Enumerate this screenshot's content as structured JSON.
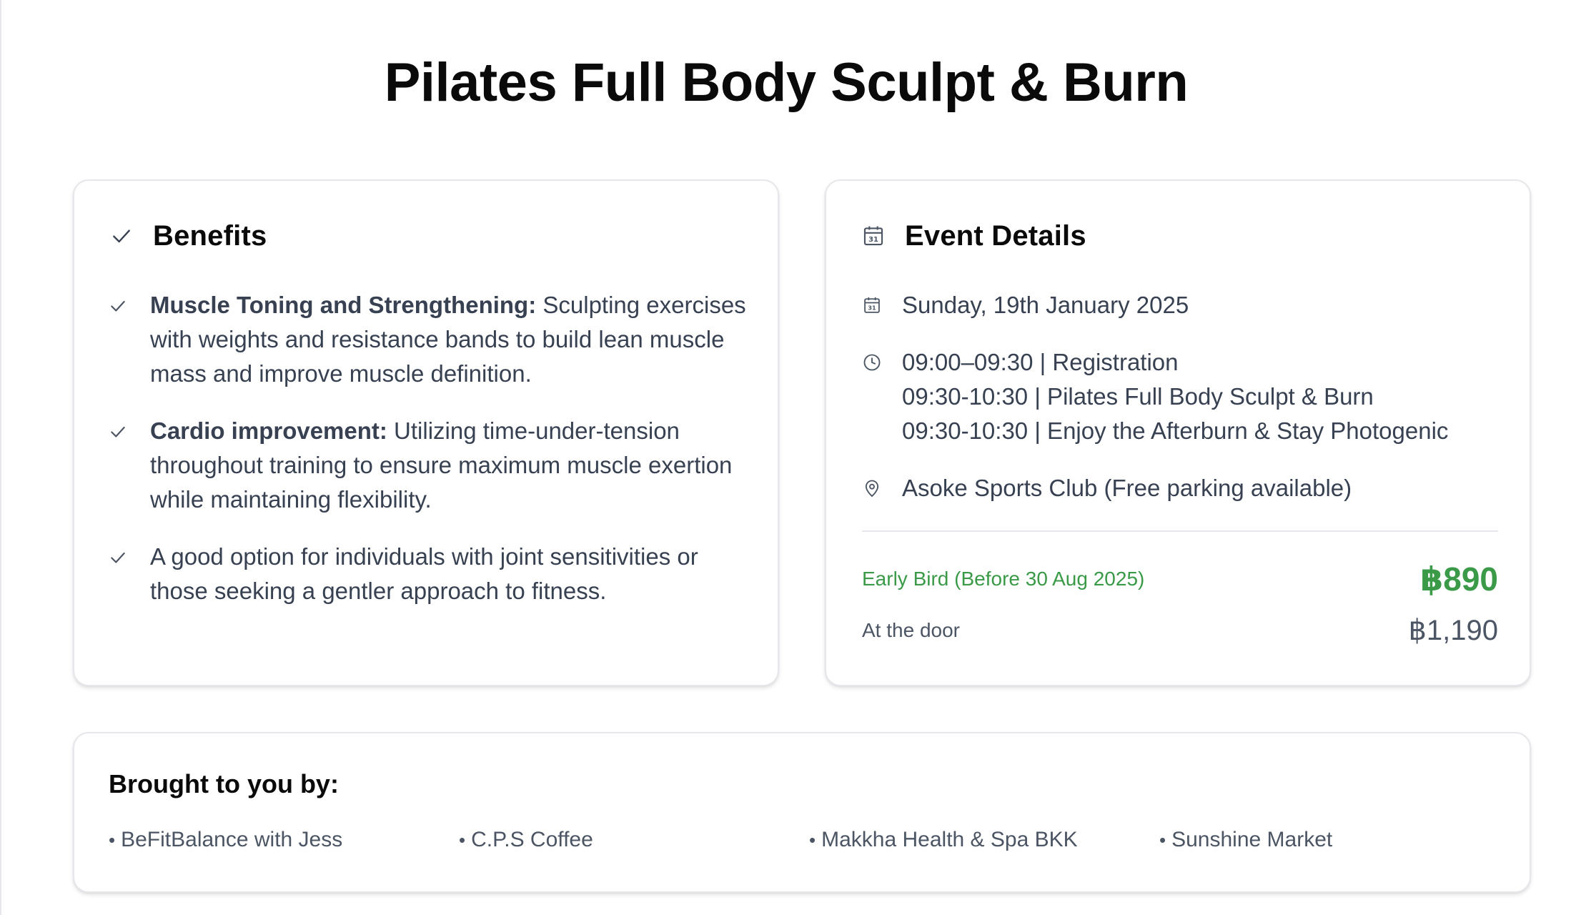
{
  "page": {
    "title": "Pilates Full Body Sculpt & Burn"
  },
  "benefits": {
    "heading": "Benefits",
    "heading_icon": "check-icon",
    "items": [
      {
        "bold": "Muscle Toning and Strengthening:",
        "text": " Sculpting exercises with weights and resistance bands to build lean muscle mass and improve muscle definition."
      },
      {
        "bold": "Cardio improvement:",
        "text": " Utilizing time-under-tension throughout training to ensure maximum muscle exertion while maintaining flexibility."
      },
      {
        "bold": "",
        "text": "A good option for individuals with joint sensitivities or those seeking a gentler approach to fitness."
      }
    ]
  },
  "event": {
    "heading": "Event Details",
    "heading_icon": "calendar-icon",
    "date": "Sunday, 19th January 2025",
    "schedule": [
      "09:00–09:30 | Registration",
      "09:30-10:30 | Pilates Full Body Sculpt & Burn",
      "09:30-10:30 | Enjoy the Afterburn & Stay Photogenic"
    ],
    "location": "Asoke Sports Club (Free parking available)",
    "early_bird_label": "Early Bird (Before 30 Aug 2025)",
    "early_bird_price": "฿890",
    "door_label": "At the door",
    "door_price": "฿1,190"
  },
  "sponsors": {
    "heading": "Brought to you by:",
    "items": [
      "BeFitBalance with Jess",
      "C.P.S Coffee",
      "Makkha Health & Spa BKK",
      "Sunshine Market"
    ]
  },
  "colors": {
    "accent_green": "#3a9a48",
    "text_body": "#374151",
    "border": "#e5e7eb"
  }
}
